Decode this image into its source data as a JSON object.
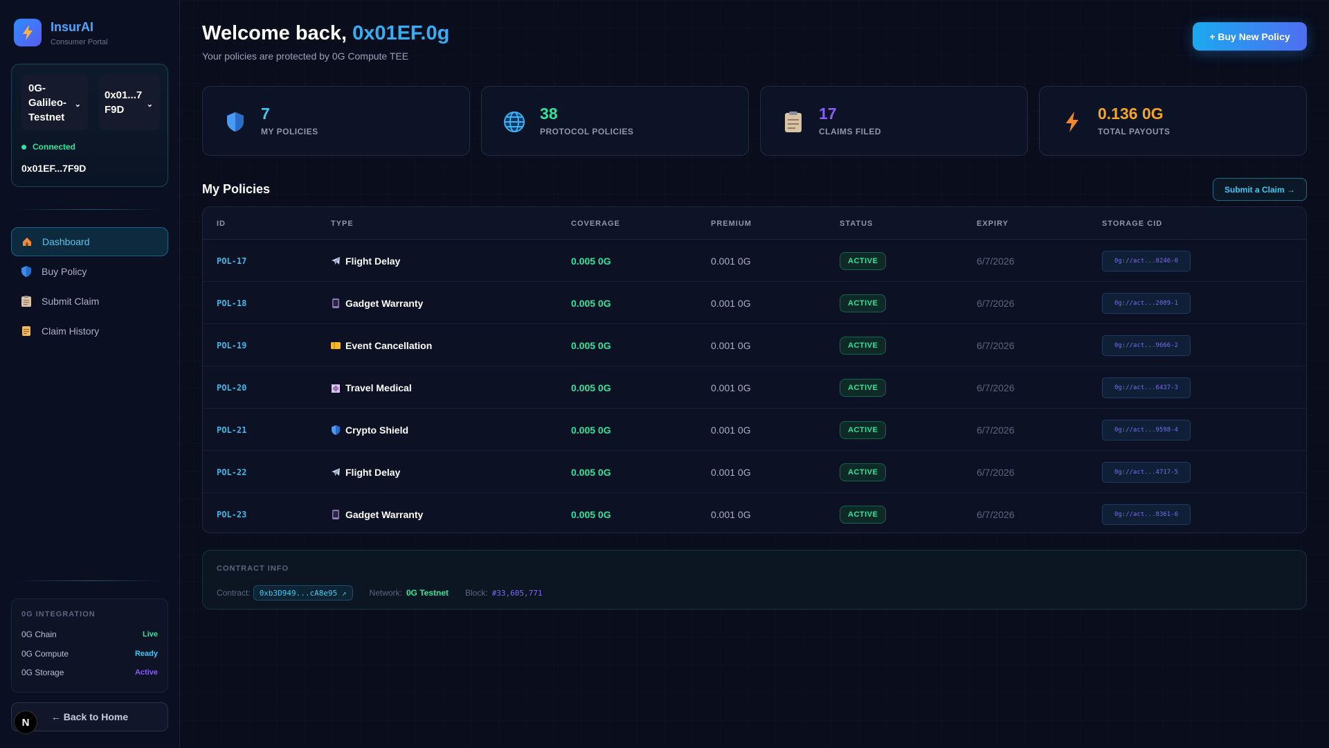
{
  "brand": {
    "name": "InsurAI",
    "subtitle": "Consumer Portal"
  },
  "wallet": {
    "network": "0G-Galileo-Testnet",
    "address_short": "0x01...7F9D",
    "status": "Connected",
    "address": "0x01EF...7F9D"
  },
  "nav": [
    {
      "label": "Dashboard",
      "icon": "home-icon",
      "active": true
    },
    {
      "label": "Buy Policy",
      "icon": "shield-icon",
      "active": false
    },
    {
      "label": "Submit Claim",
      "icon": "clipboard-icon",
      "active": false
    },
    {
      "label": "Claim History",
      "icon": "scroll-icon",
      "active": false
    }
  ],
  "integration": {
    "title": "0G INTEGRATION",
    "rows": [
      {
        "label": "0G Chain",
        "status": "Live",
        "color": "#2ee59d"
      },
      {
        "label": "0G Compute",
        "status": "Ready",
        "color": "#3fc8f2"
      },
      {
        "label": "0G Storage",
        "status": "Active",
        "color": "#8b5cf6"
      }
    ]
  },
  "back_button": "← Back to Home",
  "n_badge": "N",
  "header": {
    "greeting": "Welcome back,",
    "username": "0x01EF.0g",
    "subtitle": "Your policies are protected by 0G Compute TEE",
    "buy_button": "+ Buy New Policy"
  },
  "stats": [
    {
      "value": "7",
      "label": "MY POLICIES",
      "color": "#3fc8f2",
      "icon": "shield-icon"
    },
    {
      "value": "38",
      "label": "PROTOCOL POLICIES",
      "color": "#2ee59d",
      "icon": "globe-icon"
    },
    {
      "value": "17",
      "label": "CLAIMS FILED",
      "color": "#8b5cf6",
      "icon": "clipboard-icon"
    },
    {
      "value": "0.136 0G",
      "label": "TOTAL PAYOUTS",
      "color": "#f5a524",
      "icon": "lightning-icon"
    }
  ],
  "policies": {
    "title": "My Policies",
    "submit_button": "Submit a Claim →",
    "columns": [
      "ID",
      "TYPE",
      "COVERAGE",
      "PREMIUM",
      "STATUS",
      "EXPIRY",
      "STORAGE CID"
    ],
    "rows": [
      {
        "id": "POL-17",
        "type": "Flight Delay",
        "icon": "airplane-icon",
        "coverage": "0.005 0G",
        "premium": "0.001 0G",
        "status": "ACTIVE",
        "expiry": "6/7/2026",
        "cid": "0g://act...8246-0"
      },
      {
        "id": "POL-18",
        "type": "Gadget Warranty",
        "icon": "phone-icon",
        "coverage": "0.005 0G",
        "premium": "0.001 0G",
        "status": "ACTIVE",
        "expiry": "6/7/2026",
        "cid": "0g://act...2089-1"
      },
      {
        "id": "POL-19",
        "type": "Event Cancellation",
        "icon": "ticket-icon",
        "coverage": "0.005 0G",
        "premium": "0.001 0G",
        "status": "ACTIVE",
        "expiry": "6/7/2026",
        "cid": "0g://act...9666-2"
      },
      {
        "id": "POL-20",
        "type": "Travel Medical",
        "icon": "hospital-icon",
        "coverage": "0.005 0G",
        "premium": "0.001 0G",
        "status": "ACTIVE",
        "expiry": "6/7/2026",
        "cid": "0g://act...6437-3"
      },
      {
        "id": "POL-21",
        "type": "Crypto Shield",
        "icon": "shield-icon",
        "coverage": "0.005 0G",
        "premium": "0.001 0G",
        "status": "ACTIVE",
        "expiry": "6/7/2026",
        "cid": "0g://act...9598-4"
      },
      {
        "id": "POL-22",
        "type": "Flight Delay",
        "icon": "airplane-icon",
        "coverage": "0.005 0G",
        "premium": "0.001 0G",
        "status": "ACTIVE",
        "expiry": "6/7/2026",
        "cid": "0g://act...4717-5"
      },
      {
        "id": "POL-23",
        "type": "Gadget Warranty",
        "icon": "phone-icon",
        "coverage": "0.005 0G",
        "premium": "0.001 0G",
        "status": "ACTIVE",
        "expiry": "6/7/2026",
        "cid": "0g://act...8361-6"
      }
    ]
  },
  "contract": {
    "title": "CONTRACT INFO",
    "contract_label": "Contract:",
    "contract_address": "0xb3D949...cA8e95 ↗",
    "network_label": "Network:",
    "network_value": "0G Testnet",
    "block_label": "Block:",
    "block_value": "#33,605,771"
  }
}
